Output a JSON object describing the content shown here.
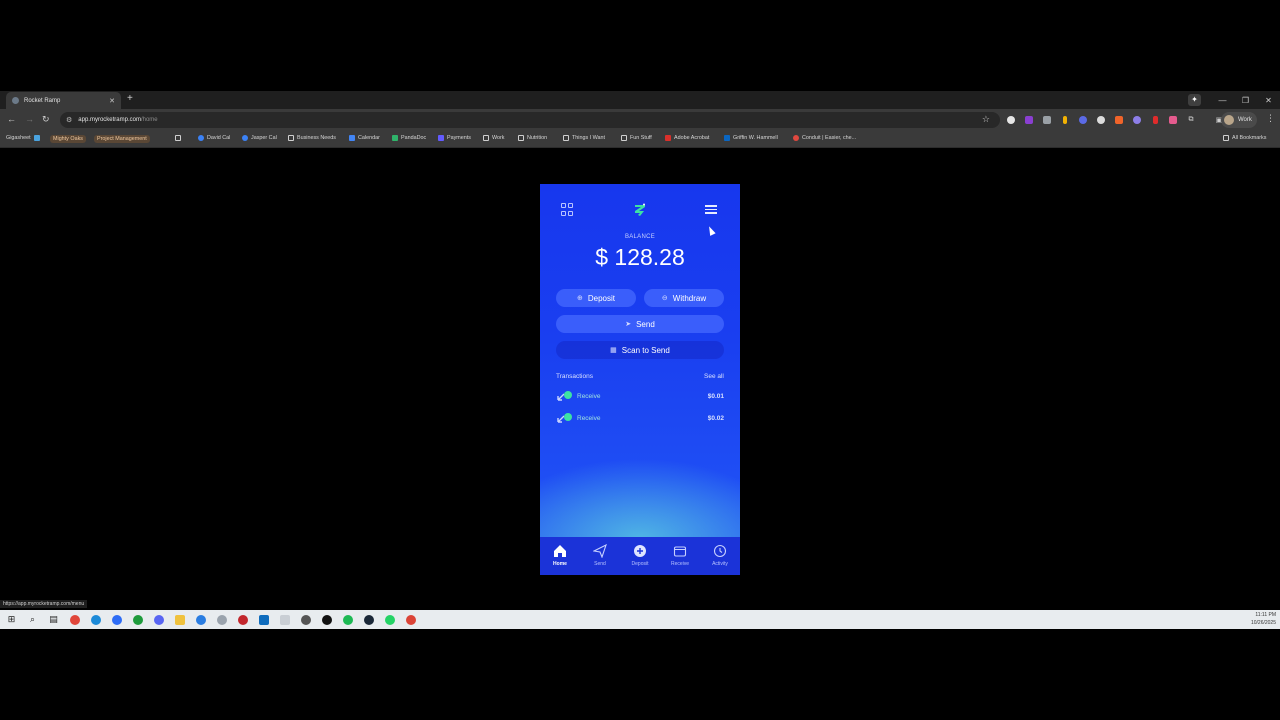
{
  "browser": {
    "tab_title": "Rocket Ramp",
    "url_host": "app.myrocketramp.com",
    "url_path": "/home",
    "profile_label": "Work",
    "status_url": "https://app.myrocketramp.com/menu"
  },
  "bookmarks": {
    "items": [
      "Gigasheet",
      "Mighty Oaks",
      "Project Management",
      "David Cal",
      "Jasper Cal",
      "Business Needs",
      "Calendar",
      "PandaDoc",
      "Payments",
      "Work",
      "Nutrition",
      "Things I Want",
      "Fun Stuff",
      "Adobe Acrobat",
      "Griffin W. Hammell",
      "Conduit | Easier, che..."
    ],
    "all_bookmarks": "All Bookmarks"
  },
  "app": {
    "balance_label": "BALANCE",
    "balance_amount": "$ 128.28",
    "deposit_label": "Deposit",
    "withdraw_label": "Withdraw",
    "send_label": "Send",
    "scan_label": "Scan to Send",
    "transactions_title": "Transactions",
    "see_all": "See all",
    "transactions": [
      {
        "label": "Receive",
        "amount": "$0.01"
      },
      {
        "label": "Receive",
        "amount": "$0.02"
      }
    ],
    "nav": [
      {
        "label": "Home"
      },
      {
        "label": "Send"
      },
      {
        "label": "Deposit"
      },
      {
        "label": "Receive"
      },
      {
        "label": "Activity"
      }
    ],
    "colors": {
      "accent": "#1a3ff0",
      "brand_green": "#3de2a3"
    }
  },
  "taskbar": {
    "time": "11:11 PM",
    "date": "10/26/2025"
  }
}
